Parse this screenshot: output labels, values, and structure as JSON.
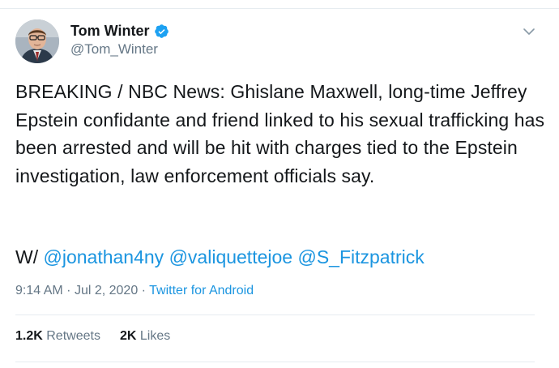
{
  "author": {
    "display_name": "Tom Winter",
    "handle": "@Tom_Winter",
    "verified": true
  },
  "tweet": {
    "text": "BREAKING / NBC News: Ghislane Maxwell, long-time Jeffrey Epstein confidante and friend linked to his sexual trafficking has been arrested and will be hit with charges tied to the Epstein investigation, law enforcement officials say.",
    "mentions_prefix": "W/",
    "mentions": [
      "@jonathan4ny",
      "@valiquettejoe",
      "@S_Fitzpatrick"
    ]
  },
  "meta": {
    "time": "9:14 AM",
    "separator": "·",
    "date": "Jul 2, 2020",
    "source": "Twitter for Android"
  },
  "stats": {
    "retweets_count": "1.2K",
    "retweets_label": "Retweets",
    "likes_count": "2K",
    "likes_label": "Likes"
  },
  "colors": {
    "link": "#1b95e0",
    "secondary_text": "#657786",
    "divider": "#e6ecf0"
  },
  "icons": [
    "verified-badge-icon",
    "chevron-down-icon"
  ]
}
